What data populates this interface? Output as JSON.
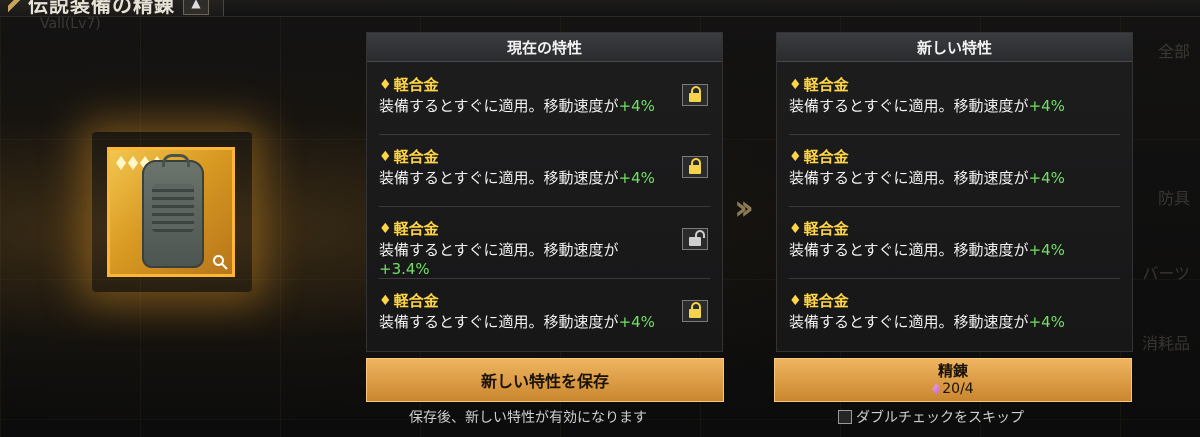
{
  "header": {
    "title": "伝説装備の精錬",
    "ghost_sub": "Vall(Lv7)"
  },
  "item": {
    "stars": 4,
    "accent": "#ffb637"
  },
  "current_panel": {
    "title": "現在の特性",
    "traits": [
      {
        "name": "軽合金",
        "desc": "装備するとすぐに適用。移動速度が",
        "value": "+4%",
        "locked": true
      },
      {
        "name": "軽合金",
        "desc": "装備するとすぐに適用。移動速度が",
        "value": "+4%",
        "locked": true
      },
      {
        "name": "軽合金",
        "desc": "装備するとすぐに適用。移動速度が",
        "value": "+3.4%",
        "locked": false
      },
      {
        "name": "軽合金",
        "desc": "装備するとすぐに適用。移動速度が",
        "value": "+4%",
        "locked": true
      }
    ]
  },
  "new_panel": {
    "title": "新しい特性",
    "traits": [
      {
        "name": "軽合金",
        "desc": "装備するとすぐに適用。移動速度が",
        "value": "+4%"
      },
      {
        "name": "軽合金",
        "desc": "装備するとすぐに適用。移動速度が",
        "value": "+4%"
      },
      {
        "name": "軽合金",
        "desc": "装備するとすぐに適用。移動速度が",
        "value": "+4%"
      },
      {
        "name": "軽合金",
        "desc": "装備するとすぐに適用。移動速度が",
        "value": "+4%"
      }
    ]
  },
  "buttons": {
    "save_label": "新しい特性を保存",
    "save_note": "保存後、新しい特性が有効になります",
    "refine_label": "精錬",
    "refine_cost": "20/4",
    "skip_label": "ダブルチェックをスキップ"
  },
  "side_menu": [
    "全部",
    "防具",
    "バーツ",
    "消耗品"
  ],
  "colors": {
    "gold": "#ffd646",
    "green": "#72e065",
    "button": "#e0a24a"
  }
}
